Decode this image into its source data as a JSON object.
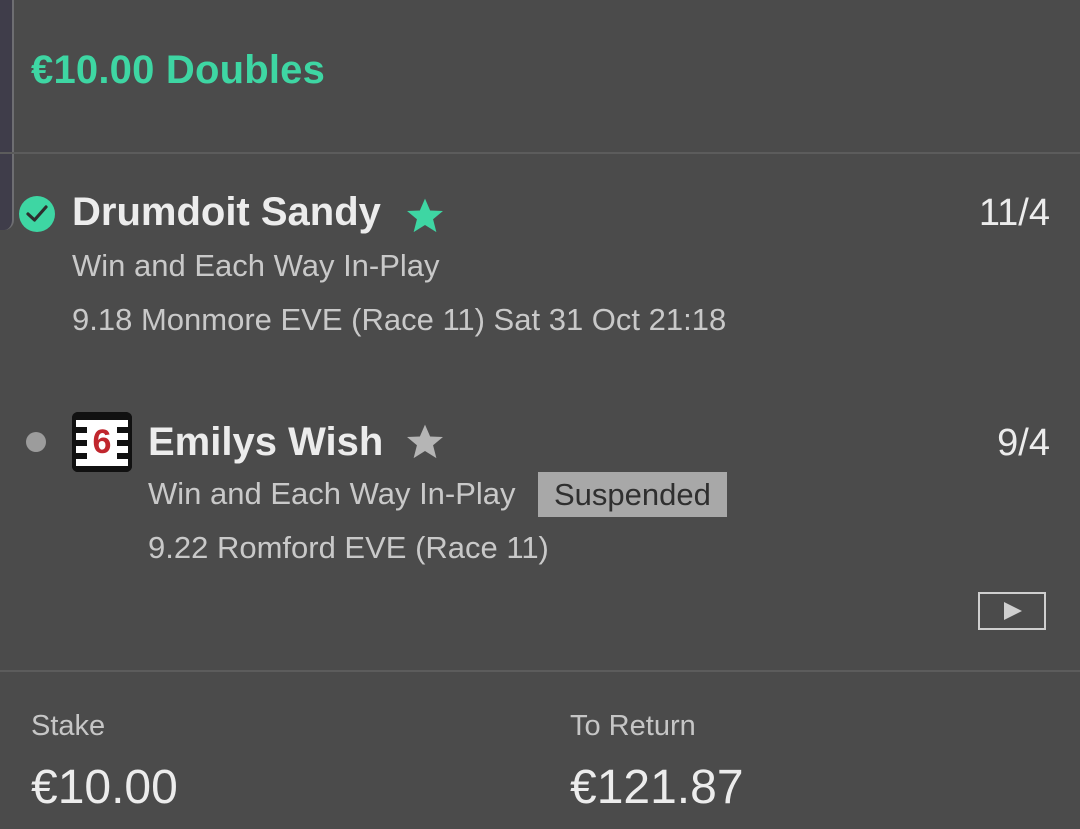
{
  "header": {
    "title": "€10.00 Doubles"
  },
  "selections": [
    {
      "name": "Drumdoit Sandy",
      "odds": "11/4",
      "market": "Win and Each Way In-Play",
      "event": "9.18 Monmore EVE (Race 11) Sat 31 Oct 21:18",
      "status": "settled-check",
      "favourite": true
    },
    {
      "name": "Emilys Wish",
      "odds": "9/4",
      "market": "Win and Each Way In-Play",
      "badge": "Suspended",
      "event": "9.22 Romford EVE (Race 11)",
      "trap_number": "6",
      "status": "pending",
      "favourite": false
    }
  ],
  "footer": {
    "stake_label": "Stake",
    "stake_value": "€10.00",
    "return_label": "To Return",
    "return_value": "€121.87"
  },
  "colors": {
    "accent": "#3ed6a3",
    "background": "#4b4b4b",
    "star_inactive": "#b5b5b5",
    "badge_bg": "#a8a8a8",
    "trap_number": "#c0262d"
  },
  "icons": {
    "selection1_status": "check-circle-icon",
    "selection2_status": "dot-icon",
    "favourite_active": "star-icon",
    "favourite_inactive": "star-icon",
    "trap": "trap-6-icon",
    "video": "play-video-icon"
  }
}
